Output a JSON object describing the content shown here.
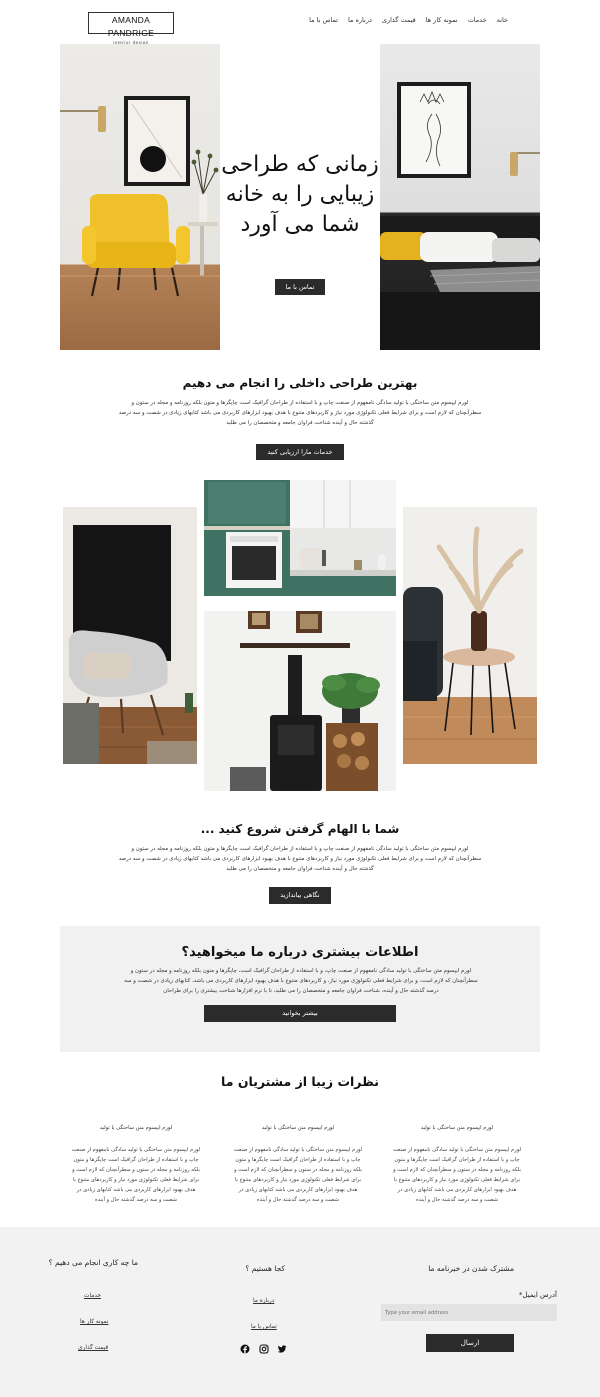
{
  "brand": {
    "name": "AMANDA PANDRIGE",
    "tagline": "interior design"
  },
  "nav": [
    "خانه",
    "خدمات",
    "نمونه کار ها",
    "قیمت گذاری",
    "درباره ما",
    "تماس با ما"
  ],
  "hero": {
    "title": "زمانی که طراحی زیبایی را به خانه شما می آورد",
    "cta": "تماس با ما"
  },
  "services": {
    "title": "بهترین طراحی داخلی را انجام می دهیم",
    "body": "لورم ایپسوم متن ساختگی با تولید سادگی نامفهوم از صنعت چاپ و با استفاده از طراحان گرافیک است چاپگرها و متون بلکه روزنامه و مجله در ستون و سطرآنچنان که لازم است و برای شرایط فعلی تکنولوژی مورد نیاز و کاربردهای متنوع با هدف بهبود ابزارهای کاربردی می باشد کتابهای زیادی در شصت و سه درصد گذشته حال و آینده شناخت فراوان جامعه و متخصصان را می طلبد",
    "cta": "خدمات مارا ارزیابی کنید"
  },
  "inspiration": {
    "title": "شما با الهام گرفتن شروع کنید ...",
    "body": "لورم ایپسوم متن ساختگی با تولید سادگی نامفهوم از صنعت چاپ و با استفاده از طراحان گرافیک است چاپگرها و متون بلکه روزنامه و مجله در ستون و سطرآنچنان که لازم است و برای شرایط فعلی تکنولوژی مورد نیاز و کاربردهای متنوع با هدف بهبود ابزارهای کاربردی می باشد کتابهای زیادی در شصت و سه درصد گذشته حال و آینده شناخت فراوان جامعه و متخصصان را می طلبد",
    "cta": "نگاهی بیاندازید"
  },
  "info": {
    "title": "اطلاعات بیشتری درباره ما میخواهید؟",
    "body": "لورم ایپسوم متن ساختگی با تولید سادگی نامفهوم از صنعت چاپ، و با استفاده از طراحان گرافیک است، چاپگرها و متون بلکه روزنامه و مجله در ستون و سطرآنچنان که لازم است، و برای شرایط فعلی تکنولوژی مورد نیاز، و کاربردهای متنوع با هدف بهبود ابزارهای کاربردی می باشد، کتابهای زیادی در شصت و سه درصد گذشته حال و آینده، شناخت فراوان جامعه و متخصصان را می طلبد، تا با نرم افزارها شناخت بیشتری را برای طراحان",
    "cta": "بیشتر بخوانید"
  },
  "testimonials": {
    "title": "نظرات زیبا از مشتریان ما",
    "items": [
      {
        "head": "لورم ایپسوم متن ساختگی با تولید",
        "text": "لورم ایپسوم متن ساختگی با تولید سادگی نامفهوم از صنعت چاپ و با استفاده از طراحان گرافیک است چاپگرها و متون بلکه روزنامه و مجله در ستون و سطرآنچنان که لازم است و برای شرایط فعلی تکنولوژی مورد نیاز و کاربردهای متنوع با هدف بهبود ابزارهای کاربردی می باشد کتابهای زیادی در شصت و سه درصد گذشته حال و آینده"
      },
      {
        "head": "لورم ایپسوم متن ساختگی با تولید",
        "text": "لورم ایپسوم متن ساختگی با تولید سادگی نامفهوم از صنعت چاپ و با استفاده از طراحان گرافیک است چاپگرها و متون بلکه روزنامه و مجله در ستون و سطرآنچنان که لازم است و برای شرایط فعلی تکنولوژی مورد نیاز و کاربردهای متنوع با هدف بهبود ابزارهای کاربردی می باشد کتابهای زیادی در شصت و سه درصد گذشته حال و آینده"
      },
      {
        "head": "لورم ایپسوم متن ساختگی با تولید",
        "text": "لورم ایپسوم متن ساختگی با تولید سادگی نامفهوم از صنعت چاپ و با استفاده از طراحان گرافیک است چاپگرها و متون بلکه روزنامه و مجله در ستون و سطرآنچنان که لازم است و برای شرایط فعلی تکنولوژی مورد نیاز و کاربردهای متنوع با هدف بهبود ابزارهای کاربردی می باشد کتابهای زیادی در شصت و سه درصد گذشته حال و آینده"
      }
    ]
  },
  "footer": {
    "services_title": "ما چه کاری انجام می دهیم ؟",
    "services_links": [
      "خدمات",
      "نمونه کار ها",
      "قیمت گذاری"
    ],
    "where_title": "کجا هستیم ؟",
    "where_links": [
      "درباره ما",
      "تماس با ما"
    ],
    "newsletter_title": "مشترک شدن در خبرنامه ما",
    "email_label": "آدرس ایمیل*",
    "email_placeholder": "Type your email address",
    "submit": "ارسال",
    "social_icons": [
      "twitter-icon",
      "instagram-icon",
      "facebook-icon"
    ]
  }
}
